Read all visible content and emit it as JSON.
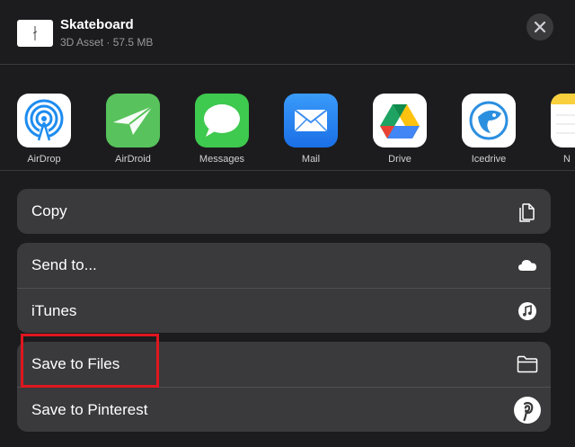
{
  "header": {
    "title": "Skateboard",
    "subtitle": "3D Asset · 57.5 MB"
  },
  "apps": [
    {
      "label": "AirDrop",
      "icon": "airdrop-icon"
    },
    {
      "label": "AirDroid",
      "icon": "airdroid-icon"
    },
    {
      "label": "Messages",
      "icon": "messages-icon"
    },
    {
      "label": "Mail",
      "icon": "mail-icon"
    },
    {
      "label": "Drive",
      "icon": "google-drive-icon"
    },
    {
      "label": "Icedrive",
      "icon": "icedrive-icon"
    },
    {
      "label": "N",
      "icon": "notes-icon"
    }
  ],
  "actions": {
    "copy": {
      "label": "Copy",
      "icon": "copy-icon"
    },
    "send_to": {
      "label": "Send to...",
      "icon": "cloud-icon"
    },
    "itunes": {
      "label": "iTunes",
      "icon": "music-note-icon"
    },
    "save_to_files": {
      "label": "Save to Files",
      "icon": "folder-icon"
    },
    "save_to_pinterest": {
      "label": "Save to Pinterest",
      "icon": "pinterest-icon"
    }
  },
  "colors": {
    "sheet_background": "#1c1c1e",
    "row_background": "#3a3a3c",
    "highlight": "#e0161e"
  }
}
